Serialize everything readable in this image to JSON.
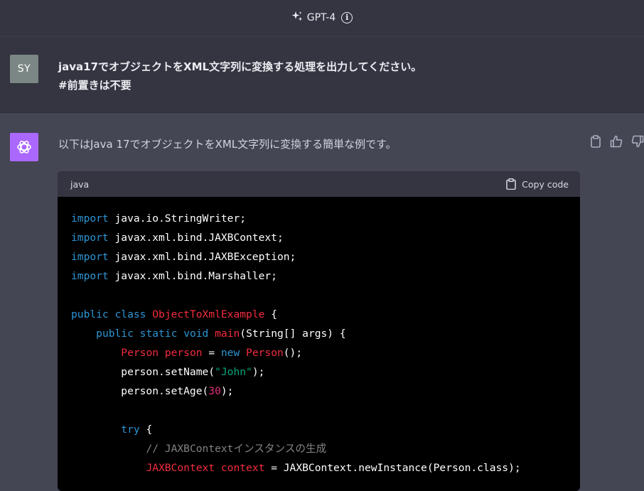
{
  "header": {
    "model_label": "GPT-4",
    "sparkle_icon": "sparkle-icon",
    "info_icon": "info-icon",
    "info_glyph": "i"
  },
  "user_message": {
    "avatar_initials": "SY",
    "lines": [
      "java17でオブジェクトをXML文字列に変換する処理を出力してください。",
      "#前置きは不要"
    ]
  },
  "assistant_message": {
    "avatar_icon": "openai-logo-icon",
    "intro": "以下はJava 17でオブジェクトをXML文字列に変換する簡単な例です。",
    "actions": [
      "clipboard-icon",
      "thumbs-up-icon",
      "thumbs-down-icon"
    ]
  },
  "code_block": {
    "language": "java",
    "copy_label": "Copy code",
    "lines": [
      [
        [
          "k",
          "import"
        ],
        [
          "p",
          " java.io.StringWriter;"
        ]
      ],
      [
        [
          "k",
          "import"
        ],
        [
          "p",
          " javax.xml.bind.JAXBContext;"
        ]
      ],
      [
        [
          "k",
          "import"
        ],
        [
          "p",
          " javax.xml.bind.JAXBException;"
        ]
      ],
      [
        [
          "k",
          "import"
        ],
        [
          "p",
          " javax.xml.bind.Marshaller;"
        ]
      ],
      [],
      [
        [
          "k",
          "public"
        ],
        [
          "p",
          " "
        ],
        [
          "k",
          "class"
        ],
        [
          "p",
          " "
        ],
        [
          "c",
          "ObjectToXmlExample"
        ],
        [
          "p",
          " {"
        ]
      ],
      [
        [
          "p",
          "    "
        ],
        [
          "k",
          "public"
        ],
        [
          "p",
          " "
        ],
        [
          "k",
          "static"
        ],
        [
          "p",
          " "
        ],
        [
          "k",
          "void"
        ],
        [
          "p",
          " "
        ],
        [
          "c",
          "main"
        ],
        [
          "p",
          "(String[] args) {"
        ]
      ],
      [
        [
          "p",
          "        "
        ],
        [
          "c",
          "Person"
        ],
        [
          "p",
          " "
        ],
        [
          "c",
          "person"
        ],
        [
          "p",
          " = "
        ],
        [
          "k",
          "new"
        ],
        [
          "p",
          " "
        ],
        [
          "c",
          "Person"
        ],
        [
          "p",
          "();"
        ]
      ],
      [
        [
          "p",
          "        person.setName("
        ],
        [
          "s",
          "\"John\""
        ],
        [
          "p",
          ");"
        ]
      ],
      [
        [
          "p",
          "        person.setAge("
        ],
        [
          "n",
          "30"
        ],
        [
          "p",
          ");"
        ]
      ],
      [],
      [
        [
          "p",
          "        "
        ],
        [
          "k",
          "try"
        ],
        [
          "p",
          " {"
        ]
      ],
      [
        [
          "p",
          "            "
        ],
        [
          "cm",
          "// JAXBContextインスタンスの生成"
        ]
      ],
      [
        [
          "p",
          "            "
        ],
        [
          "c",
          "JAXBContext"
        ],
        [
          "p",
          " "
        ],
        [
          "c",
          "context"
        ],
        [
          "p",
          " = JAXBContext.newInstance(Person.class);"
        ]
      ]
    ]
  }
}
